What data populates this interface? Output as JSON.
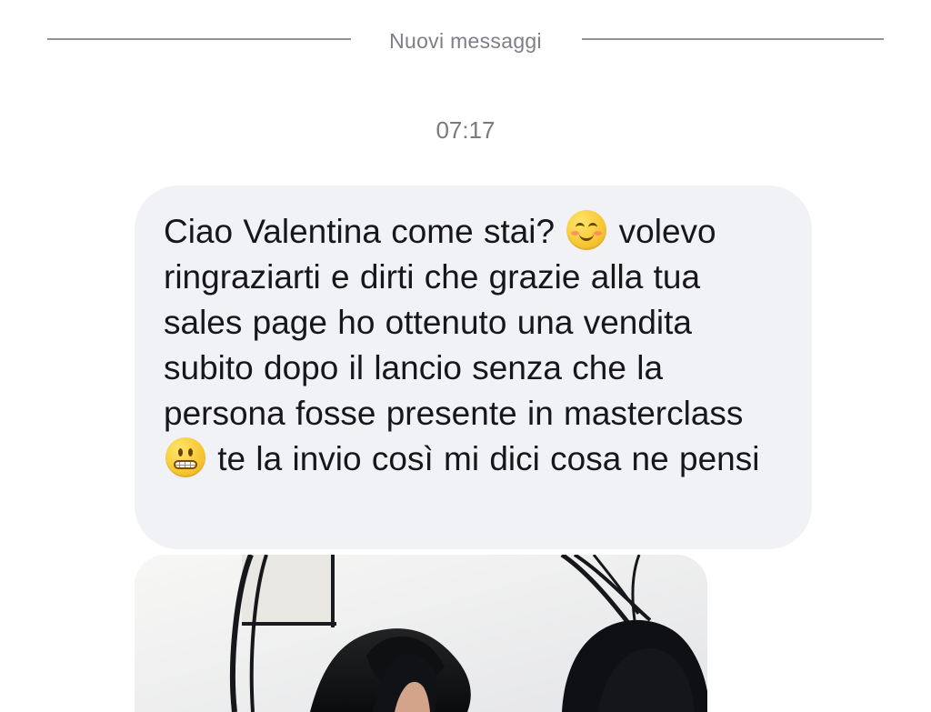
{
  "conversation": {
    "new_messages_label": "Nuovi messaggi",
    "time": "07:17",
    "messages": [
      {
        "text_parts": [
          "Ciao Valentina come stai? ",
          "smiling-blush-emoji-icon",
          " volevo ringraziarti e dirti che grazie alla tua sales page ho ottenuto una vendita subito dopo il lancio senza che la persona fosse presente in masterclass ",
          "grimacing-emoji-icon",
          " te la invio così mi dici cosa ne pensi"
        ]
      }
    ],
    "attachment": {
      "icon": "photo-thumbnail-icon"
    }
  },
  "colors": {
    "background": "#ffffff",
    "bubble": "#f1f2f5",
    "divider": "#8f939a",
    "text": "#171719",
    "muted_text": "#777a80"
  }
}
